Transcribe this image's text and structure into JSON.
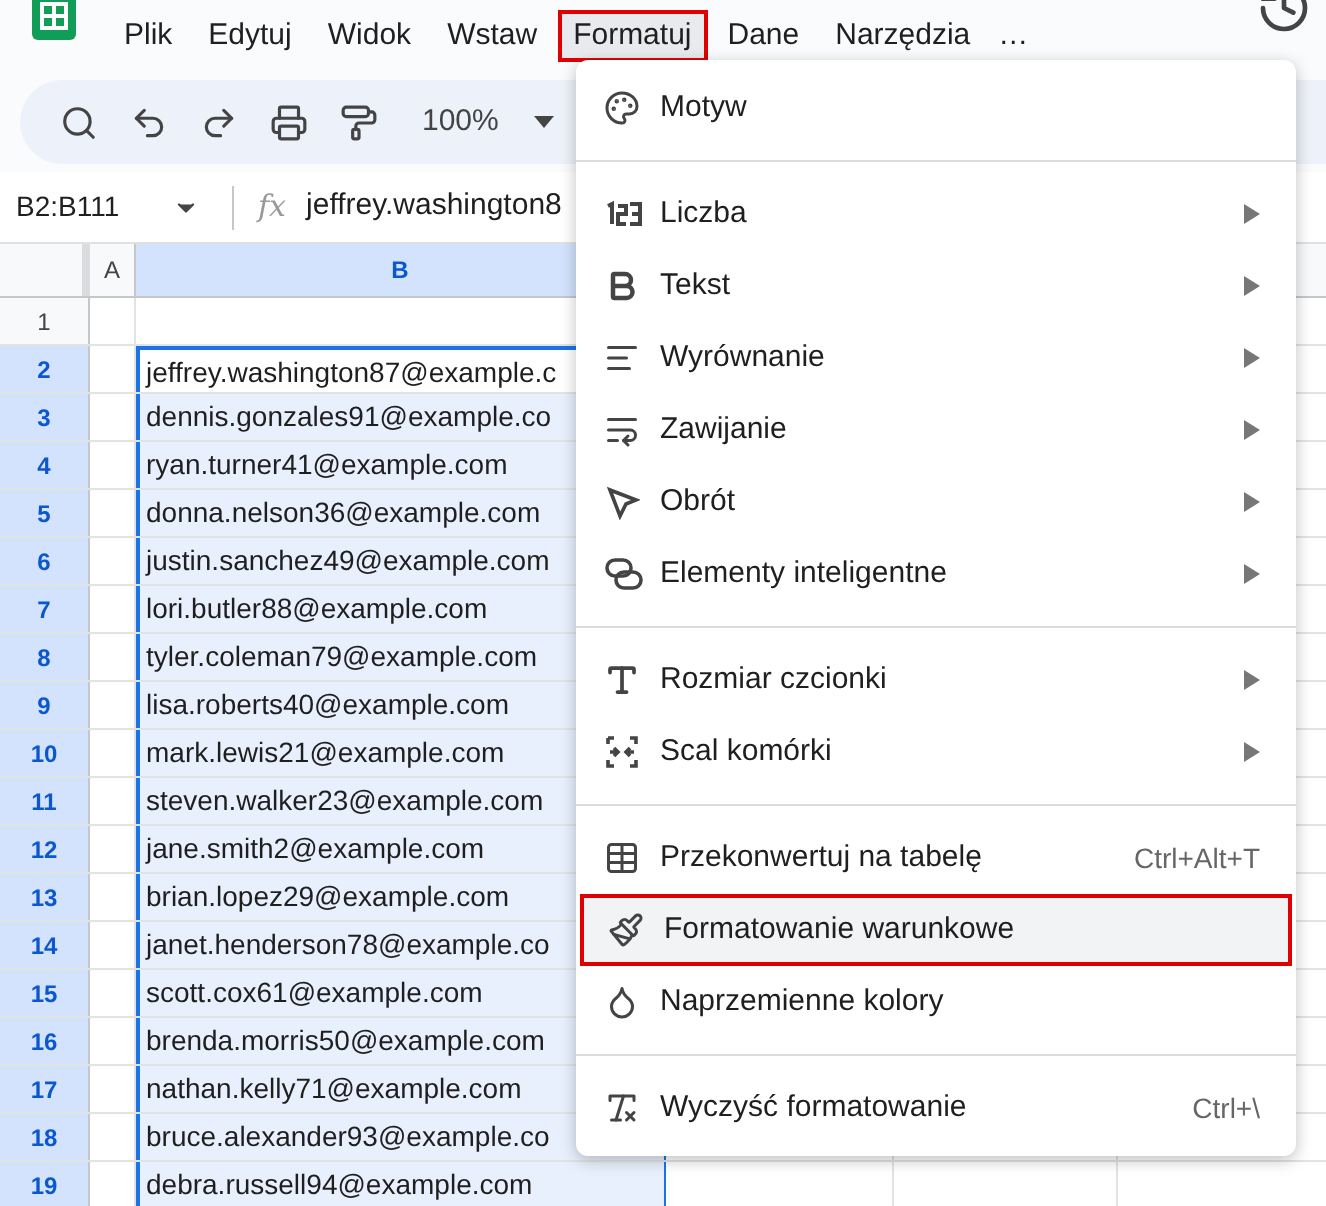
{
  "menubar": [
    {
      "label": "Plik",
      "selected": false
    },
    {
      "label": "Edytuj",
      "selected": false
    },
    {
      "label": "Widok",
      "selected": false
    },
    {
      "label": "Wstaw",
      "selected": false
    },
    {
      "label": "Formatuj",
      "selected": true
    },
    {
      "label": "Dane",
      "selected": false
    },
    {
      "label": "Narzędzia",
      "selected": false
    }
  ],
  "menubar_more": "…",
  "toolbar": {
    "zoom": "100%"
  },
  "formula_bar": {
    "name_box": "B2:B111",
    "fx": "fx",
    "formula": "jeffrey.washington8"
  },
  "grid": {
    "column_headers": [
      {
        "label": "A",
        "selected": false
      },
      {
        "label": "B",
        "selected": true
      }
    ],
    "rows": [
      {
        "number": "1",
        "selected": false
      },
      {
        "number": "2",
        "selected": true,
        "b": "jeffrey.washington87@example.c"
      },
      {
        "number": "3",
        "selected": true,
        "b": "dennis.gonzales91@example.co"
      },
      {
        "number": "4",
        "selected": true,
        "b": "ryan.turner41@example.com"
      },
      {
        "number": "5",
        "selected": true,
        "b": "donna.nelson36@example.com"
      },
      {
        "number": "6",
        "selected": true,
        "b": "justin.sanchez49@example.com"
      },
      {
        "number": "7",
        "selected": true,
        "b": "lori.butler88@example.com"
      },
      {
        "number": "8",
        "selected": true,
        "b": "tyler.coleman79@example.com"
      },
      {
        "number": "9",
        "selected": true,
        "b": "lisa.roberts40@example.com"
      },
      {
        "number": "10",
        "selected": true,
        "b": "mark.lewis21@example.com"
      },
      {
        "number": "11",
        "selected": true,
        "b": "steven.walker23@example.com"
      },
      {
        "number": "12",
        "selected": true,
        "b": "jane.smith2@example.com"
      },
      {
        "number": "13",
        "selected": true,
        "b": "brian.lopez29@example.com"
      },
      {
        "number": "14",
        "selected": true,
        "b": "janet.henderson78@example.co"
      },
      {
        "number": "15",
        "selected": true,
        "b": "scott.cox61@example.com"
      },
      {
        "number": "16",
        "selected": true,
        "b": "brenda.morris50@example.com"
      },
      {
        "number": "17",
        "selected": true,
        "b": "nathan.kelly71@example.com"
      },
      {
        "number": "18",
        "selected": true,
        "b": "bruce.alexander93@example.co"
      },
      {
        "number": "19",
        "selected": true,
        "b": "debra.russell94@example.com"
      }
    ]
  },
  "format_menu": {
    "sections": [
      [
        {
          "label": "Motyw",
          "submenu": false,
          "selected": false
        }
      ],
      [
        {
          "label": "Liczba",
          "submenu": true,
          "selected": false
        },
        {
          "label": "Tekst",
          "submenu": true,
          "selected": false
        },
        {
          "label": "Wyrównanie",
          "submenu": true,
          "selected": false
        },
        {
          "label": "Zawijanie",
          "submenu": true,
          "selected": false
        },
        {
          "label": "Obrót",
          "submenu": true,
          "selected": false
        },
        {
          "label": "Elementy inteligentne",
          "submenu": true,
          "selected": false
        }
      ],
      [
        {
          "label": "Rozmiar czcionki",
          "submenu": true,
          "selected": false
        },
        {
          "label": "Scal komórki",
          "submenu": true,
          "selected": false
        }
      ],
      [
        {
          "label": "Przekonwertuj na tabelę",
          "submenu": false,
          "shortcut": "Ctrl+Alt+T",
          "selected": false
        },
        {
          "label": "Formatowanie warunkowe",
          "submenu": false,
          "selected": true
        },
        {
          "label": "Naprzemienne kolory",
          "submenu": false,
          "selected": false
        }
      ],
      [
        {
          "label": "Wyczyść formatowanie",
          "submenu": false,
          "shortcut": "Ctrl+\\",
          "selected": false
        }
      ]
    ]
  }
}
